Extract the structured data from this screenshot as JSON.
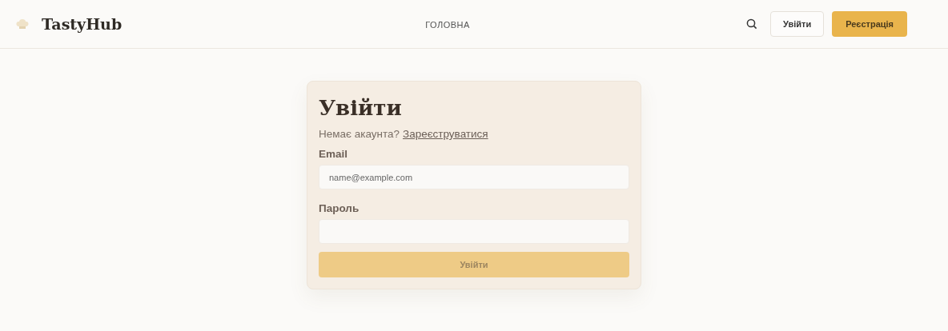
{
  "header": {
    "logo_text": "TastyHub",
    "nav": [
      {
        "label": "ГОЛОВНА",
        "selected": false
      }
    ],
    "login_button": "Увійти",
    "register_button": "Реєстрація"
  },
  "login_card": {
    "title": "Увійти",
    "prompt": "Немає акаунта?",
    "signup_link": "Зареєструватися",
    "fields": [
      {
        "label": "Email",
        "placeholder": "name@example.com"
      },
      {
        "label": "Пароль"
      }
    ],
    "submit": {
      "label": "Увійти",
      "disabled": true
    }
  }
}
